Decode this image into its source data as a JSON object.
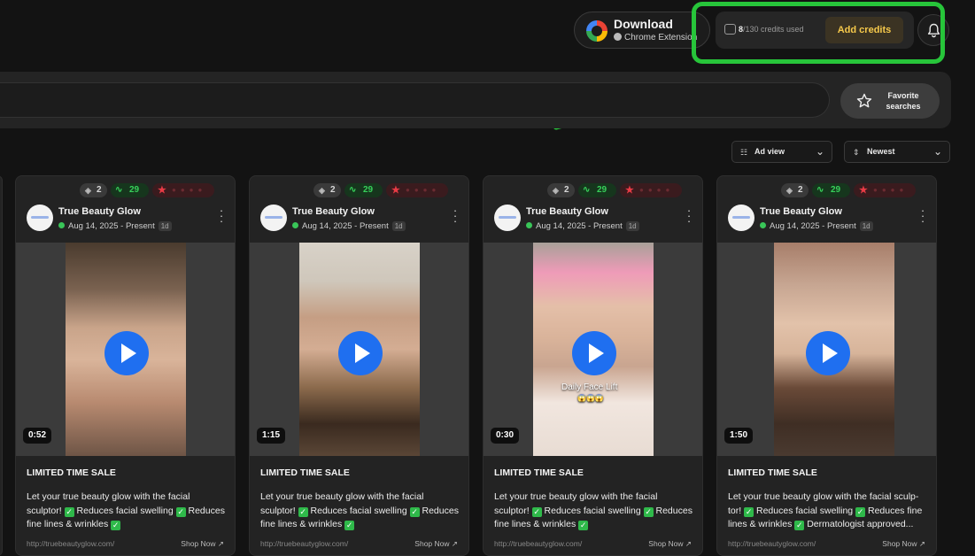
{
  "header": {
    "download": {
      "title": "Download",
      "subtitle": "Chrome Extension",
      "logo_icon": "google-logo-icon",
      "chrome_icon": "chrome-icon"
    },
    "credits": {
      "used": "8",
      "total_text": "/130 credits used",
      "add_label": "Add credits",
      "icon": "coins-icon"
    },
    "notifications_icon": "bell-icon"
  },
  "annotation": {
    "color": "#27c53a"
  },
  "search": {
    "placeholder": "",
    "favorite_label": "Favorite searches",
    "favorite_icon": "star-outline-icon"
  },
  "controls": {
    "view": {
      "label": "Ad view",
      "icon": "list-icon"
    },
    "sort": {
      "label": "Newest",
      "icon": "sort-icon"
    }
  },
  "colors": {
    "accent": "#1f6ff0",
    "credits_accent": "#f6c94b",
    "score_green": "#37d05a",
    "rating_red": "#e83b45"
  },
  "cards": [
    {
      "copies": "2",
      "score": "29",
      "brand": "True Beauty Glow",
      "date": "Aug 14, 2025 - Present",
      "age": "1d",
      "duration": "0:52",
      "overlay": "",
      "headline": "LIMITED TIME SALE",
      "body_1": "Let your true beauty glow with the facial sculptor! ",
      "body_2": " Reduces facial swelling ",
      "body_3": " Reduces fine lines & wrinkles ",
      "url": "http://truebeautyglow.com/",
      "cta": "Shop Now ↗"
    },
    {
      "copies": "2",
      "score": "29",
      "brand": "True Beauty Glow",
      "date": "Aug 14, 2025 - Present",
      "age": "1d",
      "duration": "1:15",
      "overlay": "",
      "headline": "LIMITED TIME SALE",
      "body_1": "Let your true beauty glow with the facial sculptor! ",
      "body_2": " Reduces facial swelling ",
      "body_3": " Reduces fine lines & wrinkles ",
      "url": "http://truebeautyglow.com/",
      "cta": "Shop Now ↗"
    },
    {
      "copies": "2",
      "score": "29",
      "brand": "True Beauty Glow",
      "date": "Aug 14, 2025 - Present",
      "age": "1d",
      "duration": "0:30",
      "overlay": "Daily Face Lift",
      "overlay_emoji": "😱😱😱",
      "headline": "LIMITED TIME SALE",
      "body_1": "Let your true beauty glow with the facial sculptor! ",
      "body_2": " Reduces facial swelling ",
      "body_3": " Reduces fine lines & wrinkles ",
      "url": "http://truebeautyglow.com/",
      "cta": "Shop Now ↗"
    },
    {
      "copies": "2",
      "score": "29",
      "brand": "True Beauty Glow",
      "date": "Aug 14, 2025 - Present",
      "age": "1d",
      "duration": "1:50",
      "overlay": "",
      "headline": "LIMITED TIME SALE",
      "body_1": "Let your true beauty glow with the facial sculp-tor! ",
      "body_2": " Reduces facial swelling ",
      "body_3": " Reduces fine lines & wrinkles ",
      "body_4": " Dermatologist approved...",
      "url": "http://truebeautyglow.com/",
      "cta": "Shop Now ↗"
    }
  ]
}
